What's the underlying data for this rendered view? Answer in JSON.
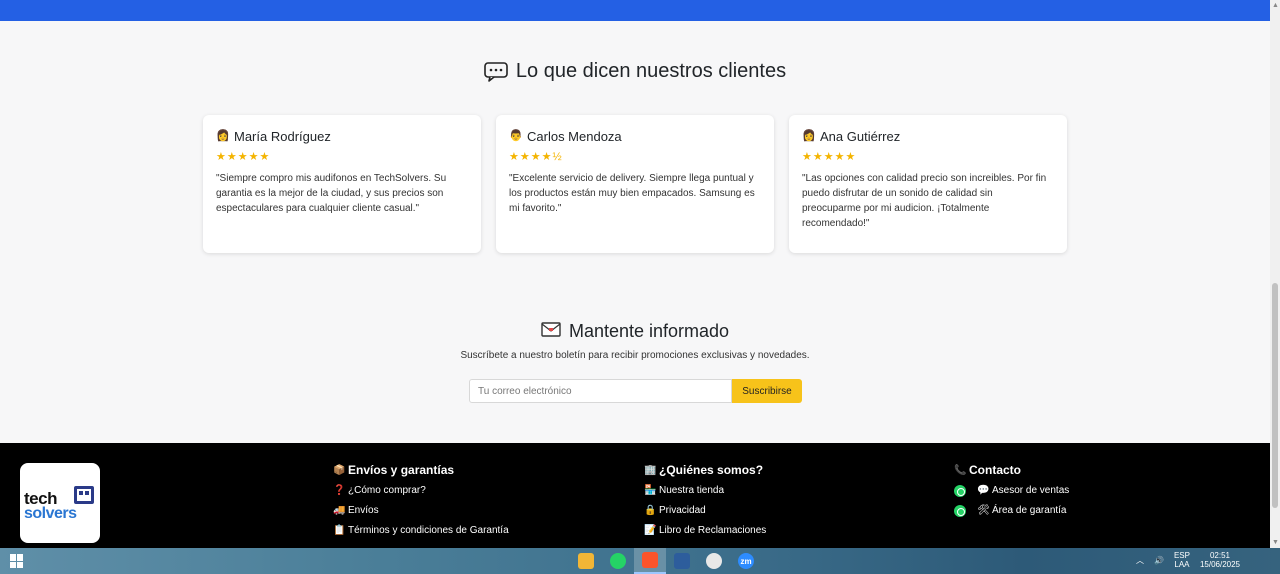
{
  "testimonials": {
    "title": "Lo que dicen nuestros clientes",
    "reviews": [
      {
        "name": "María Rodríguez",
        "avatar": "👩",
        "stars": "★★★★★",
        "text": "\"Siempre compro mis audifonos en TechSolvers. Su garantia es la mejor de la ciudad, y sus precios son espectaculares para cualquier cliente casual.\""
      },
      {
        "name": "Carlos Mendoza",
        "avatar": "👨",
        "stars": "★★★★½",
        "text": "\"Excelente servicio de delivery. Siempre llega puntual y los productos están muy bien empacados. Samsung es mi favorito.\""
      },
      {
        "name": "Ana Gutiérrez",
        "avatar": "👩",
        "stars": "★★★★★",
        "text": "\"Las opciones con calidad precio son increibles. Por fin puedo disfrutar de un sonido de calidad sin preocuparme por mi audicion. ¡Totalmente recomendado!\""
      }
    ]
  },
  "newsletter": {
    "title": "Mantente informado",
    "subtitle": "Suscríbete a nuestro boletín para recibir promociones exclusivas y novedades.",
    "placeholder": "Tu correo electrónico",
    "button": "Suscribirse"
  },
  "footer": {
    "logo_top": "tech",
    "logo_bottom": "solvers",
    "col1": {
      "title": "Envíos y garantías",
      "items": [
        "¿Cómo comprar?",
        "Envíos",
        "Términos y condiciones de Garantía"
      ]
    },
    "col2": {
      "title": "¿Quiénes somos?",
      "items": [
        "Nuestra tienda",
        "Privacidad",
        "Libro de Reclamaciones"
      ]
    },
    "col3": {
      "title": "Contacto",
      "items": [
        "Asesor de ventas",
        "Área de garantía"
      ]
    }
  },
  "taskbar": {
    "lang_top": "ESP",
    "lang_bottom": "LAA",
    "time": "02:51",
    "date": "15/06/2025"
  },
  "colors": {
    "brand_blue": "#2460e4",
    "accent_yellow": "#f7c31a",
    "star": "#f4b400"
  }
}
